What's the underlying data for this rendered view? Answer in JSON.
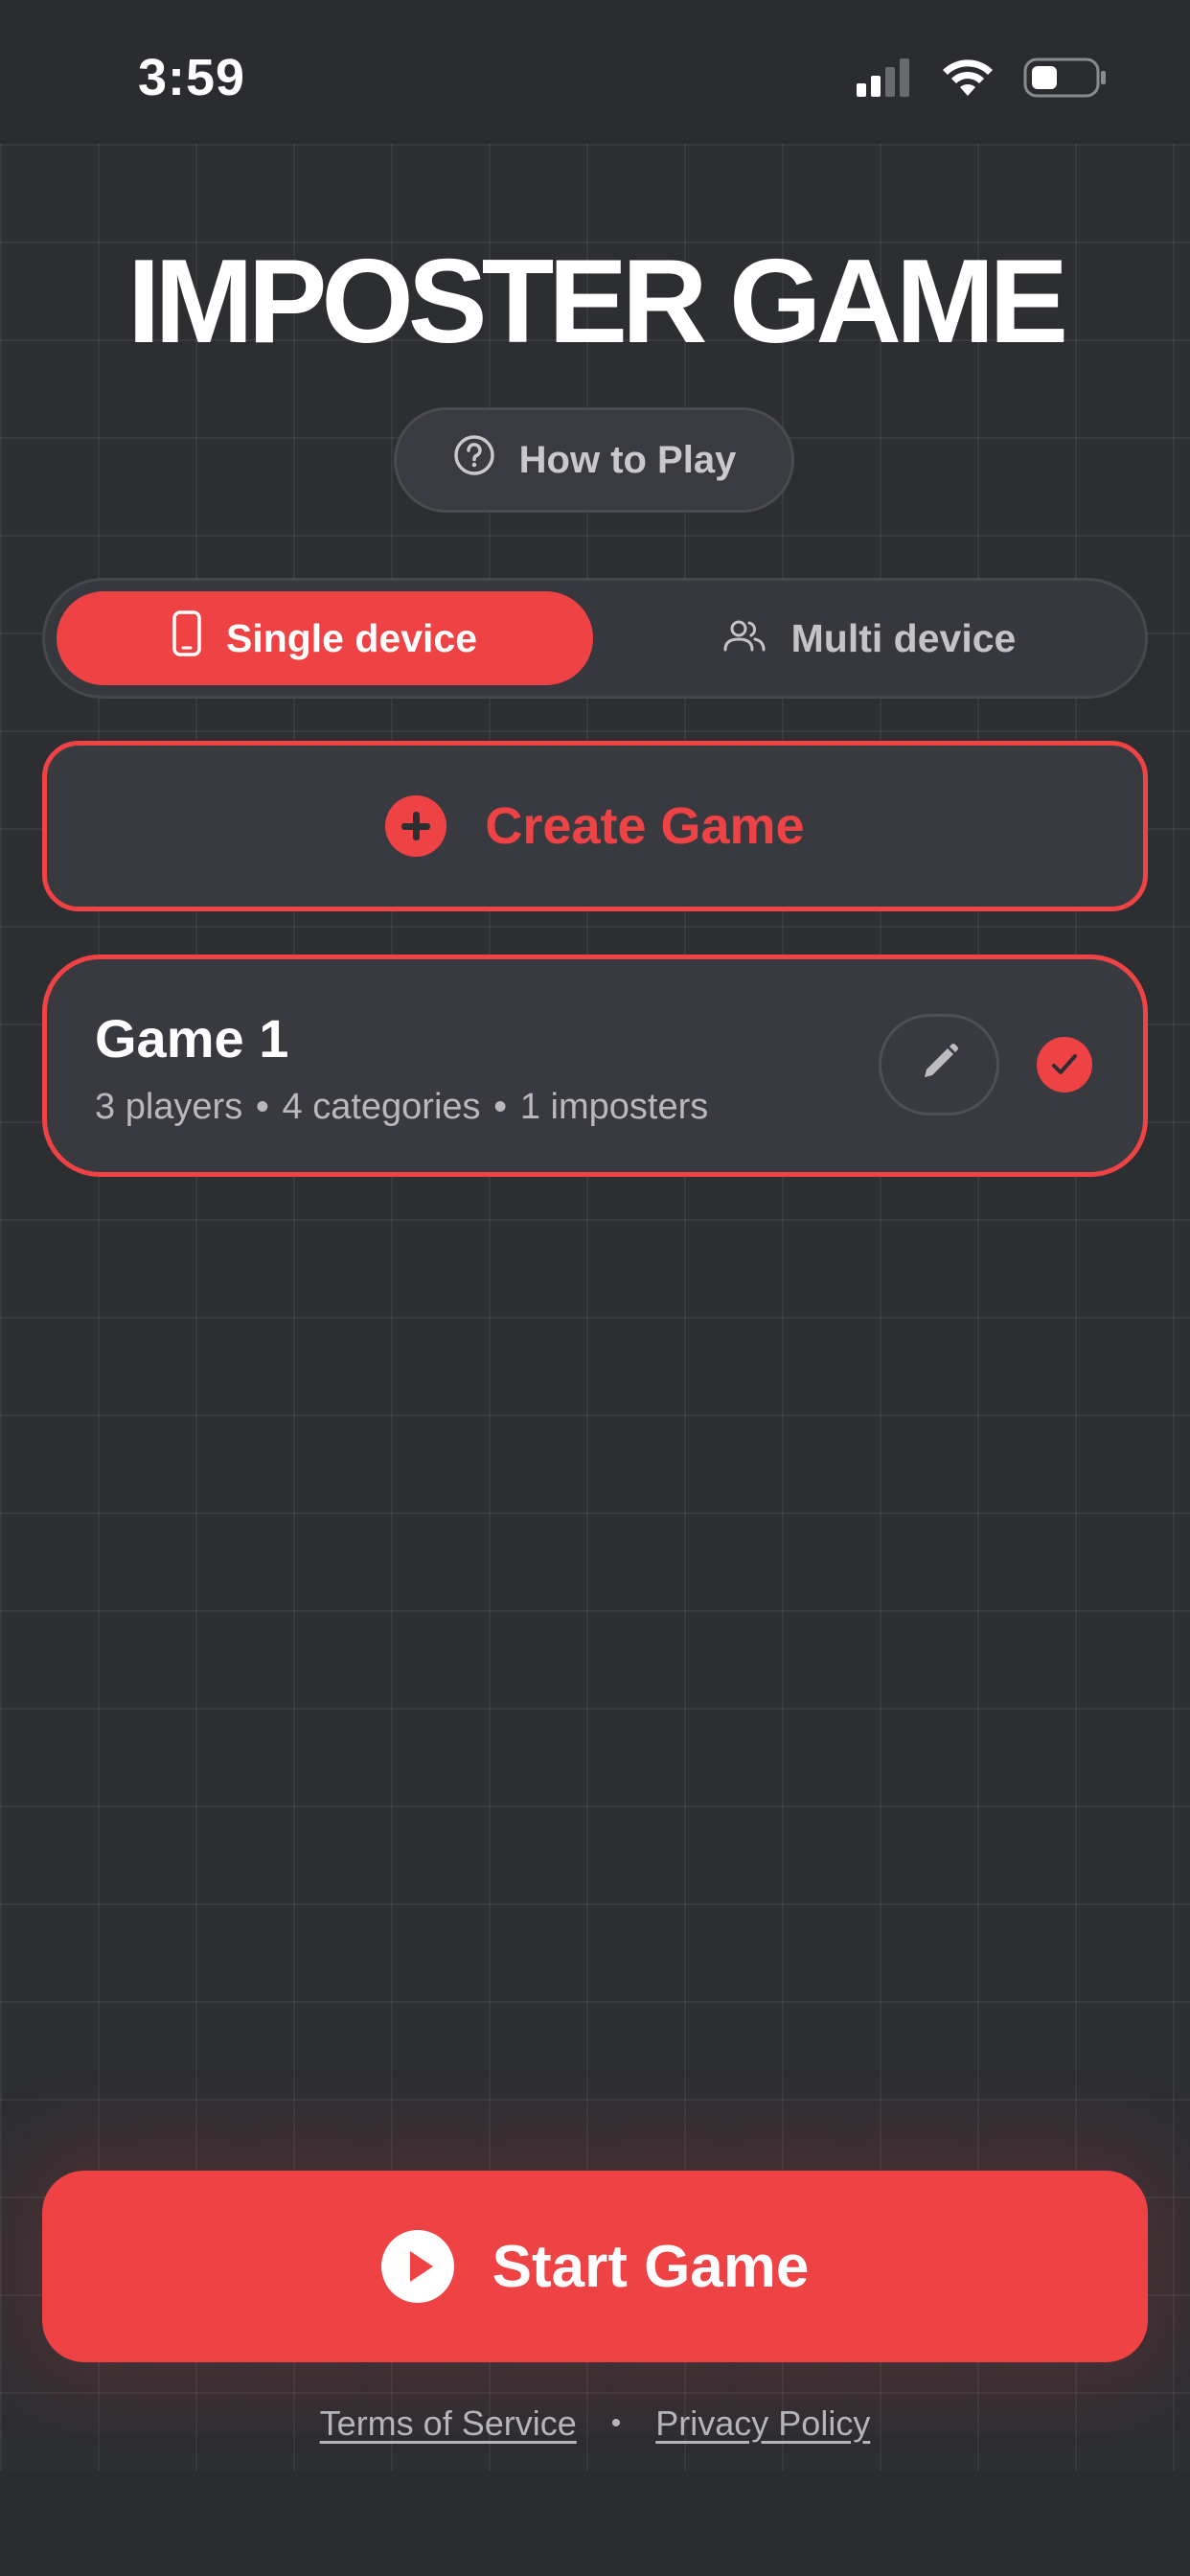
{
  "status_bar": {
    "time": "3:59",
    "icons": [
      "cellular-signal-icon",
      "wifi-icon",
      "battery-icon"
    ]
  },
  "app": {
    "title": "IMPOSTER GAME"
  },
  "how_to_play": {
    "label": "How to Play",
    "icon": "question-circle-icon"
  },
  "mode_selector": {
    "options": [
      {
        "label": "Single device",
        "icon": "phone-icon",
        "selected": true
      },
      {
        "label": "Multi device",
        "icon": "users-icon",
        "selected": false
      }
    ]
  },
  "create_game": {
    "label": "Create Game",
    "icon": "plus-circle-icon"
  },
  "games": [
    {
      "name": "Game 1",
      "players": "3 players",
      "categories": "4 categories",
      "imposters": "1 imposters",
      "separator": "•",
      "selected": true
    }
  ],
  "start_game": {
    "label": "Start Game",
    "icon": "play-circle-icon"
  },
  "footer": {
    "terms": "Terms of Service",
    "separator": "•",
    "privacy": "Privacy Policy"
  },
  "colors": {
    "accent": "#ef4245",
    "background": "#2b2c30",
    "card": "#393a3f"
  }
}
